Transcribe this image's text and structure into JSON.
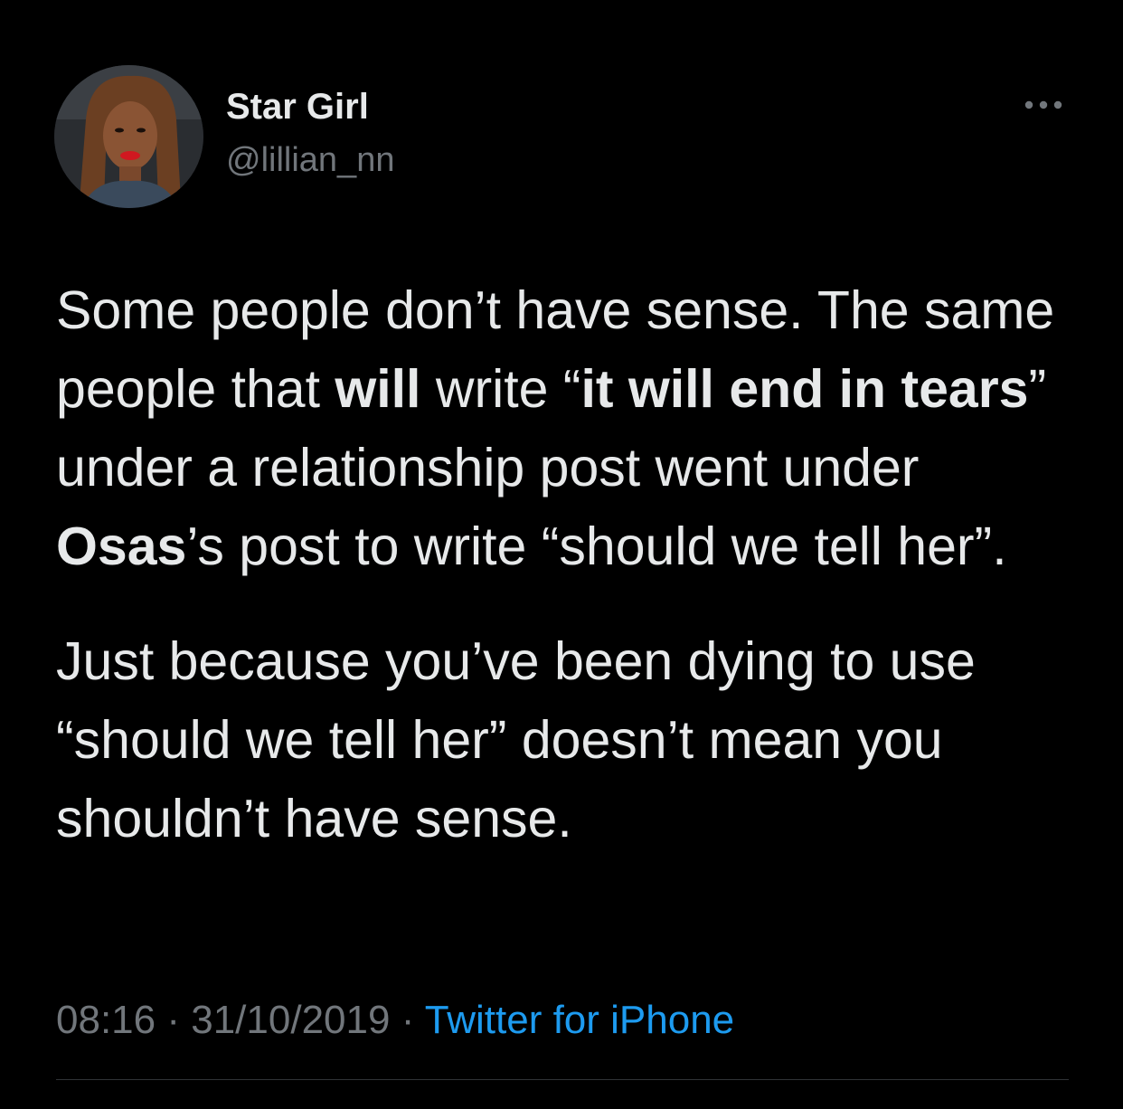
{
  "author": {
    "display_name": "Star Girl",
    "handle": "@lillian_nn"
  },
  "tweet": {
    "paragraph_1": {
      "t1": "Some people don’t have sense. The same people that ",
      "b1": "will",
      "t2": " write “",
      "b2": "it will end in tears",
      "t3": "” under a relationship post went under ",
      "b3": "Osas",
      "t4": "’s post to write “should we tell her”."
    },
    "paragraph_2": "Just because you’ve been dying to use “should we tell her” doesn’t mean you shouldn’t have sense."
  },
  "meta": {
    "time": "08:16",
    "separator": "·",
    "date": "31/10/2019",
    "source": "Twitter for iPhone"
  },
  "icons": {
    "avatar": "profile-photo",
    "more": "more-horizontal-icon"
  },
  "colors": {
    "background": "#000000",
    "text": "#e7e9ea",
    "secondary": "#71767b",
    "link": "#1d9bf0",
    "divider": "#2f3336"
  }
}
